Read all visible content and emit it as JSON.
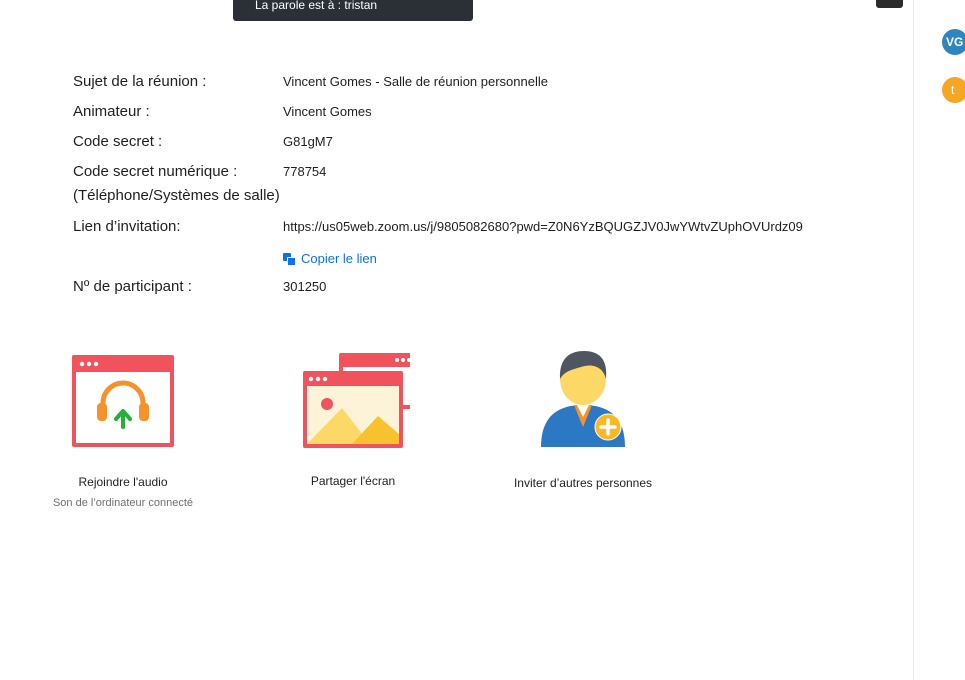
{
  "banner": {
    "text": "La parole est à : tristan"
  },
  "participants": [
    {
      "initials": "VG",
      "color": "#2e86c1"
    },
    {
      "initials": "t",
      "color": "#f5a623"
    }
  ],
  "meeting": {
    "subject_label": "Sujet de la réunion :",
    "subject_value": "Vincent Gomes - Salle de réunion personnelle",
    "host_label": "Animateur :",
    "host_value": "Vincent Gomes",
    "passcode_label": "Code secret :",
    "passcode_value": "G81gM7",
    "numeric_passcode_label": "Code secret numérique :",
    "numeric_passcode_sub": "(Téléphone/Systèmes de salle)",
    "numeric_passcode_value": "778754",
    "invite_link_label": "Lien d’invitation:",
    "invite_link_value": "https://us05web.zoom.us/j/9805082680?pwd=Z0N6YzBQUGZJV0JwYWtvZUphOVUrdz09",
    "copy_link_label": "Copier le lien",
    "participant_id_label": "Nº de participant :",
    "participant_id_value": "301250"
  },
  "actions": {
    "join_audio": {
      "label": "Rejoindre l'audio",
      "sublabel": "Son de l’ordinateur connecté",
      "icon": "join-audio-icon"
    },
    "share_screen": {
      "label": "Partager l'écran",
      "icon": "share-screen-icon"
    },
    "invite": {
      "label": "Inviter d’autres personnes",
      "icon": "invite-participants-icon"
    }
  },
  "colors": {
    "accent": "#0e71eb",
    "window_red": "#f0535b",
    "headset_orange": "#f5922a",
    "arrow_green": "#27ae3c",
    "person_blue": "#2d78c5",
    "plus_yellow": "#f7b924"
  }
}
